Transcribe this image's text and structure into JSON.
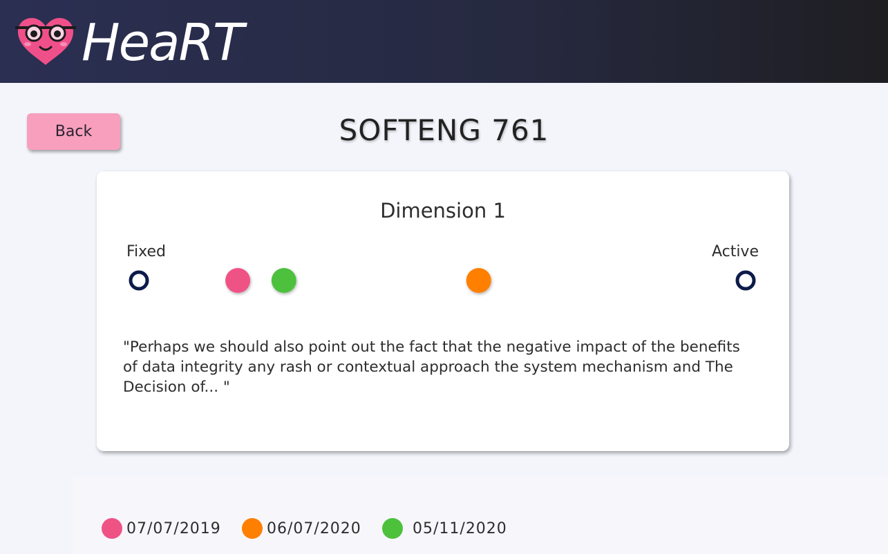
{
  "header": {
    "logo_text": "HeaRT"
  },
  "page": {
    "back_label": "Back",
    "title": "SOFTENG 761"
  },
  "card": {
    "dimension_title": "Dimension 1",
    "left_label": "Fixed",
    "right_label": "Active",
    "quote": "\"Perhaps we should also point out the fact that the negative impact of the benefits of data integrity any rash or contextual approach the system mechanism and The Decision of... \""
  },
  "scale": {
    "line_color": "#0d1b4a",
    "markers": [
      {
        "date": "07/07/2019",
        "color": "#ef5386",
        "position": 0.163
      },
      {
        "date": "05/11/2020",
        "color": "#4ec13c",
        "position": 0.239
      },
      {
        "date": "06/07/2020",
        "color": "#ff7f00",
        "position": 0.56
      }
    ]
  },
  "legend": [
    {
      "label": "07/07/2019",
      "color": "#ef5386"
    },
    {
      "label": "06/07/2020",
      "color": "#ff7f00"
    },
    {
      "label": "05/11/2020",
      "color": "#4ec13c"
    }
  ]
}
